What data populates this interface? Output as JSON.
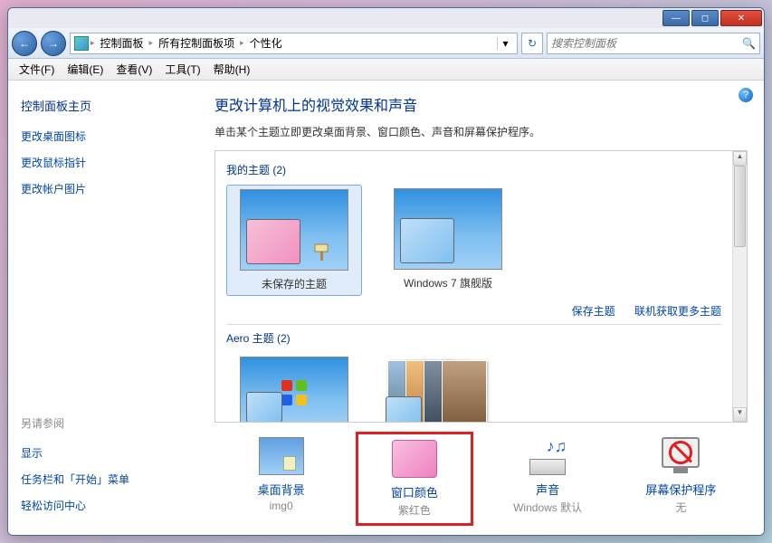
{
  "titlebar": {
    "min": "—",
    "max": "◻",
    "close": "✕"
  },
  "nav": {
    "back": "←",
    "forward": "→",
    "refresh": "↻"
  },
  "breadcrumb": {
    "items": [
      "控制面板",
      "所有控制面板项",
      "个性化"
    ],
    "sep": "▸",
    "dropdown": "▾"
  },
  "search": {
    "placeholder": "搜索控制面板",
    "icon": "🔍"
  },
  "menubar": [
    "文件(F)",
    "编辑(E)",
    "查看(V)",
    "工具(T)",
    "帮助(H)"
  ],
  "sidebar": {
    "title": "控制面板主页",
    "links": [
      "更改桌面图标",
      "更改鼠标指针",
      "更改帐户图片"
    ],
    "seealso_title": "另请参阅",
    "seealso": [
      "显示",
      "任务栏和「开始」菜单",
      "轻松访问中心"
    ]
  },
  "content": {
    "help": "?",
    "heading": "更改计算机上的视觉效果和声音",
    "subtext": "单击某个主题立即更改桌面背景、窗口颜色、声音和屏幕保护程序。",
    "my_themes_label": "我的主题 (2)",
    "my_themes": [
      {
        "caption": "未保存的主题",
        "overlay": "pink",
        "selected": true
      },
      {
        "caption": "Windows 7 旗舰版",
        "overlay": "blue",
        "selected": false
      }
    ],
    "theme_links": {
      "save": "保存主题",
      "more": "联机获取更多主题"
    },
    "aero_label": "Aero 主题 (2)"
  },
  "options": [
    {
      "label": "桌面背景",
      "sub": "img0",
      "icon": "desktop",
      "highlighted": false
    },
    {
      "label": "窗口颜色",
      "sub": "紫红色",
      "icon": "color",
      "highlighted": true
    },
    {
      "label": "声音",
      "sub": "Windows 默认",
      "icon": "sound",
      "highlighted": false
    },
    {
      "label": "屏幕保护程序",
      "sub": "无",
      "icon": "saver",
      "highlighted": false
    }
  ]
}
